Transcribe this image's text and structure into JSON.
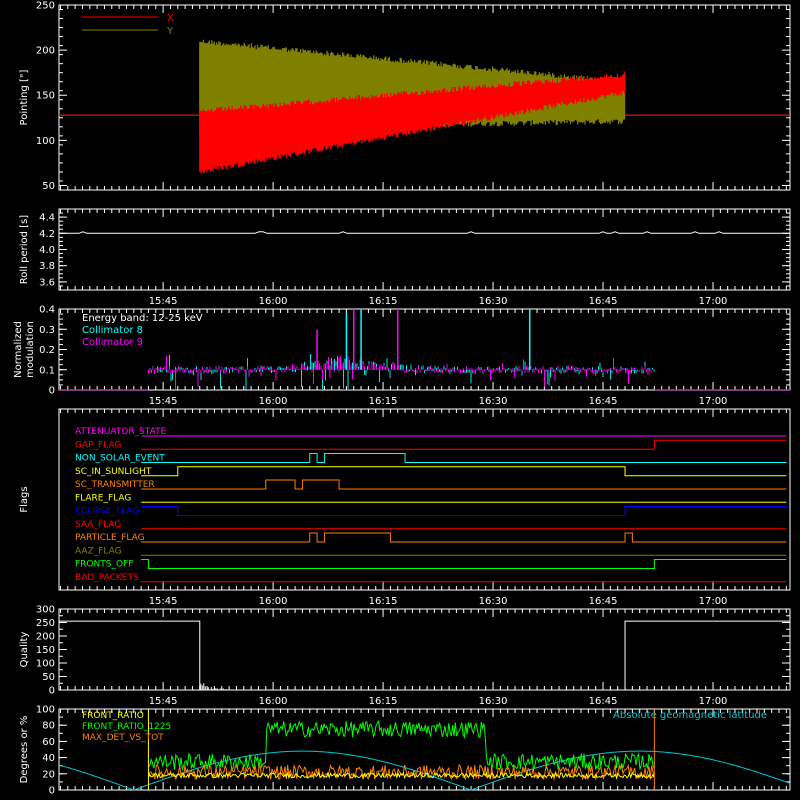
{
  "time_ticks": [
    "15:45",
    "16:00",
    "16:15",
    "16:30",
    "16:45",
    "17:00"
  ],
  "chart_data": [
    {
      "id": "pointing",
      "type": "line",
      "ylabel": "Pointing [\"]",
      "ylim": [
        45,
        250
      ],
      "yticks": [
        50,
        100,
        150,
        200,
        250
      ],
      "legend": {
        "placement": "top-left"
      },
      "series": [
        {
          "name": "X",
          "color": "#ff0000",
          "baseline": 128,
          "active_window": [
            "15:50",
            "16:48"
          ],
          "upper_start": 135,
          "upper_end": 176,
          "lower_start": 62,
          "lower_end": 150
        },
        {
          "name": "Y",
          "color": "#808000",
          "baseline": 128,
          "active_window": [
            "15:50",
            "16:48"
          ],
          "upper_start": 213,
          "upper_end": 168,
          "lower_start": 110,
          "lower_end": 118
        }
      ]
    },
    {
      "id": "roll_period",
      "type": "line",
      "ylabel": "Roll period [s]",
      "ylim": [
        3.5,
        4.5
      ],
      "yticks": [
        "3.6",
        "3.8",
        "4.0",
        "4.2",
        "4.4"
      ],
      "series": [
        {
          "name": "",
          "color": "#ffffff",
          "value": 4.2
        }
      ]
    },
    {
      "id": "modulation",
      "type": "line",
      "ylabel": "Normalized modulation",
      "ylim": [
        0,
        0.4
      ],
      "yticks": [
        "0",
        "0.1",
        "0.2",
        "0.3",
        "0.4"
      ],
      "annotation": "Energy band: 12-25 keV",
      "active_window": [
        "15:43",
        "16:52"
      ],
      "series": [
        {
          "name": "Collimator 8",
          "color": "#00ffff",
          "baseline": 0.1
        },
        {
          "name": "Collimator 9",
          "color": "#ff00ff",
          "baseline": 0.1
        }
      ]
    },
    {
      "id": "flags",
      "type": "line",
      "ylabel": "Flags",
      "series": [
        {
          "name": "ATTENUATOR_STATE",
          "color": "#ff00ff",
          "segments": [
            [
              "15:42",
              "17:10",
              0
            ]
          ]
        },
        {
          "name": "GAP_FLAG",
          "color": "#ff0000",
          "segments": [
            [
              "15:42",
              "16:52",
              0
            ],
            [
              "16:52",
              "17:10",
              1
            ]
          ]
        },
        {
          "name": "NON_SOLAR_EVENT",
          "color": "#00ffff",
          "segments": [
            [
              "15:42",
              "16:05",
              0
            ],
            [
              "16:05",
              "16:06",
              1
            ],
            [
              "16:06",
              "16:07",
              0
            ],
            [
              "16:07",
              "16:18",
              1
            ],
            [
              "16:18",
              "17:10",
              0
            ]
          ]
        },
        {
          "name": "SC_IN_SUNLIGHT",
          "color": "#ffff00",
          "segments": [
            [
              "15:42",
              "15:47",
              0
            ],
            [
              "15:47",
              "16:48",
              1
            ],
            [
              "16:48",
              "17:10",
              0
            ]
          ]
        },
        {
          "name": "SC_TRANSMITTER",
          "color": "#ff8000",
          "segments": [
            [
              "15:42",
              "15:59",
              0
            ],
            [
              "15:59",
              "16:03",
              1
            ],
            [
              "16:03",
              "16:04",
              0
            ],
            [
              "16:04",
              "16:09",
              1
            ],
            [
              "16:09",
              "17:10",
              0
            ]
          ]
        },
        {
          "name": "FLARE_FLAG",
          "color": "#ffff00",
          "segments": [
            [
              "15:42",
              "17:10",
              0
            ]
          ]
        },
        {
          "name": "ECLIPSE_FLAG",
          "color": "#0000ff",
          "segments": [
            [
              "15:42",
              "15:47",
              1
            ],
            [
              "15:47",
              "16:48",
              0
            ],
            [
              "16:48",
              "17:10",
              1
            ]
          ]
        },
        {
          "name": "SAA_FLAG",
          "color": "#ff0000",
          "segments": [
            [
              "15:42",
              "17:10",
              0
            ]
          ]
        },
        {
          "name": "PARTICLE_FLAG",
          "color": "#ff8000",
          "segments": [
            [
              "15:42",
              "16:05",
              0
            ],
            [
              "16:05",
              "16:06",
              1
            ],
            [
              "16:06",
              "16:07",
              0
            ],
            [
              "16:07",
              "16:16",
              1
            ],
            [
              "16:16",
              "16:48",
              0
            ],
            [
              "16:48",
              "16:49",
              1
            ],
            [
              "16:49",
              "17:10",
              0
            ]
          ]
        },
        {
          "name": "AAZ_FLAG",
          "color": "#808000",
          "segments": [
            [
              "15:42",
              "17:10",
              0
            ]
          ]
        },
        {
          "name": "FRONTS_OFF",
          "color": "#00ff00",
          "segments": [
            [
              "15:42",
              "15:43",
              1
            ],
            [
              "15:43",
              "16:52",
              0
            ],
            [
              "16:52",
              "17:10",
              1
            ]
          ]
        },
        {
          "name": "BAD_PACKETS",
          "color": "#ff0000",
          "segments": [
            [
              "15:42",
              "17:10",
              0
            ]
          ]
        }
      ]
    },
    {
      "id": "quality",
      "type": "line",
      "ylabel": "Quality",
      "ylim": [
        0,
        300
      ],
      "yticks": [
        "0",
        "50",
        "100",
        "150",
        "200",
        "250",
        "300"
      ],
      "series": [
        {
          "name": "",
          "color": "#ffffff",
          "high_value": 255,
          "high_windows": [
            [
              "15:42",
              "15:50"
            ],
            [
              "16:48",
              "17:10"
            ]
          ],
          "low_value": 0
        }
      ]
    },
    {
      "id": "ratios",
      "type": "line",
      "ylabel": "Degrees or %",
      "ylim": [
        0,
        100
      ],
      "yticks": [
        "0",
        "20",
        "40",
        "60",
        "80",
        "100"
      ],
      "annotation": "Absolute geomagnetic latitude",
      "series": [
        {
          "name": "FRONT_RATIO",
          "color": "#ffff00",
          "mean": 18
        },
        {
          "name": "FRONT_RATIO_1225",
          "color": "#00ff00",
          "mean": 45
        },
        {
          "name": "MAX_DET_VS_TOT",
          "color": "#ff8000",
          "mean": 22
        },
        {
          "name": "",
          "color": "#00c8d0",
          "mean": 25
        }
      ]
    }
  ]
}
